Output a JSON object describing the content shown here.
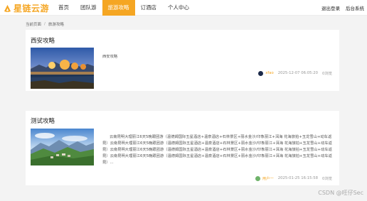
{
  "app": {
    "logo_text": "星链云游",
    "brand_color": "#f5a623"
  },
  "nav": {
    "items": [
      {
        "label": "首页",
        "active": false
      },
      {
        "label": "团队游",
        "active": false
      },
      {
        "label": "旅游攻略",
        "active": true
      },
      {
        "label": "订酒店",
        "active": false
      },
      {
        "label": "个人中心",
        "active": false
      }
    ],
    "logout_label": "退出登录",
    "admin_label": "后台系统"
  },
  "breadcrumb": {
    "items": [
      "当前页面",
      "旅游攻略"
    ],
    "separator": "/"
  },
  "guides": [
    {
      "title": "西安攻略",
      "image_icon": "lake-sunset-image",
      "summary": "西安攻略",
      "author": "xfao",
      "time": "2025-12-07 06:05:20",
      "views": "0浏览"
    },
    {
      "title": "测试攻略",
      "image_icon": "mountain-village-image",
      "summary": "云南昆明大理丽江6天5晚跟团游（温德姆国际五星酒店+温泉酒店+石林景区+丽水金沙/印象丽江+洱海 花海旅拍+玉龙雪山+动车返昆）云南昆明大理丽江6天5晚跟团游（温德姆国际五星酒店+温泉酒店+石林景区+丽水金沙/印象丽江+洱海 花海旅拍+玉龙雪山+动车返昆）云南昆明大理丽江6天5晚跟团游（温德姆国际五星酒店+温泉酒店+石林景区+丽水金沙/印象丽江+洱海 花海旅拍+玉龙雪山+动车返昆）云南昆明大理丽江6天5晚跟团游（温德姆国际五星酒店+温泉酒店+石林景区+丽水金沙/印象丽江+洱海 花海旅拍+玉龙雪山+动车返昆）...",
      "author": "用户一",
      "time": "2025-01-25 16:15:58",
      "views": "0浏览"
    }
  ],
  "watermark": "CSDN @旺仔Sec"
}
